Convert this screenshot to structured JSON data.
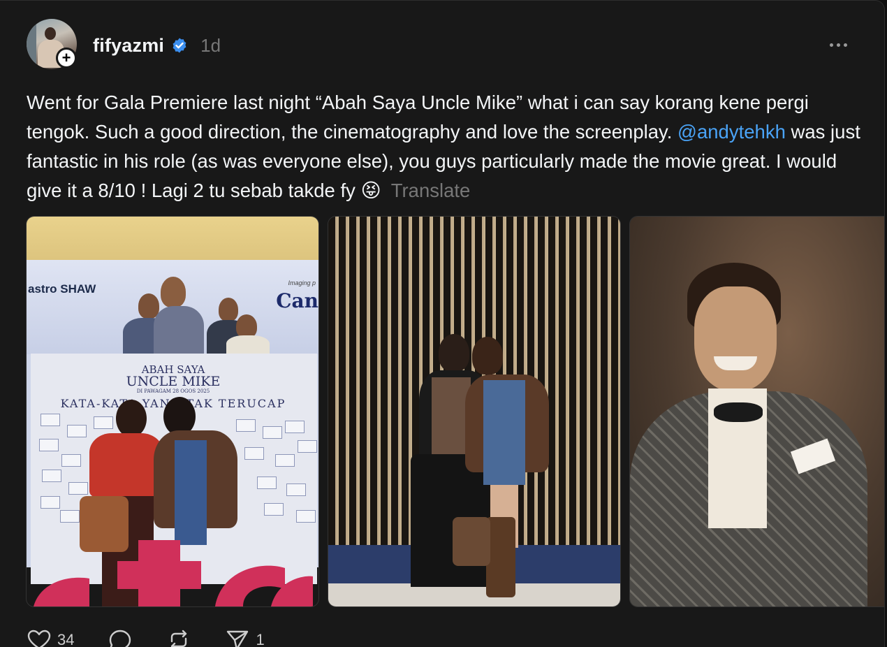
{
  "post": {
    "username": "fifyazmi",
    "time": "1d",
    "text_part1": "Went for Gala Premiere last night “Abah Saya Uncle Mike” what i can say korang kene pergi tengok. Such a good direction, the cinematography and love the screenplay. ",
    "mention": "@andytehkh",
    "text_part2": " was just fantastic in his role (as was everyone else), you guys particularly made the movie great. I would give it a 8/10 ! Lagi 2 tu sebab takde fy ",
    "emoji": "😝",
    "translate_label": "Translate"
  },
  "media": {
    "photo1": {
      "logo": "astro SHAW",
      "imaging_text": "Imaging p",
      "brand_text": "Can",
      "movie_title_line1": "ABAH SAYA",
      "movie_title_line2": "UNCLE MIKE",
      "release_text": "DI PAWAGAM 28 OGOS 2025",
      "tagline": "KATA-KATA YANG TAK TERUCAP"
    }
  },
  "actions": {
    "like_count": "34",
    "reply_count": "",
    "repost_count": "",
    "share_count": "1"
  },
  "colors": {
    "background": "#101010",
    "card": "#181818",
    "mention": "#4aa3f6",
    "verified": "#3b8ff0",
    "muted": "#777777"
  }
}
